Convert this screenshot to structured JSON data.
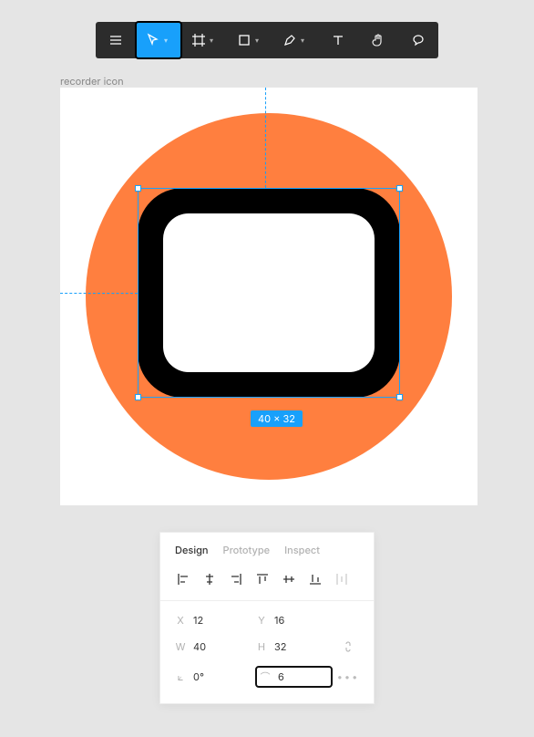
{
  "frame": {
    "label": "recorder icon"
  },
  "selection": {
    "dim_label": "40 × 32"
  },
  "panel": {
    "tabs": {
      "design": "Design",
      "prototype": "Prototype",
      "inspect": "Inspect"
    },
    "x": {
      "lbl": "X",
      "val": "12"
    },
    "y": {
      "lbl": "Y",
      "val": "16"
    },
    "w": {
      "lbl": "W",
      "val": "40"
    },
    "h": {
      "lbl": "H",
      "val": "32"
    },
    "rot": {
      "lbl": "⟀",
      "val": "0°"
    },
    "rad": {
      "lbl": "⌒",
      "val": "6"
    }
  }
}
